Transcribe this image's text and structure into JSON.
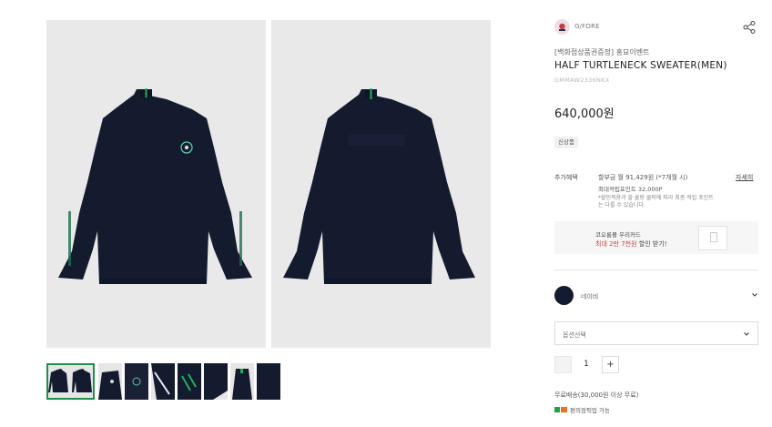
{
  "gallery": {
    "main_images": [
      {
        "label": "front-view"
      },
      {
        "label": "back-view"
      }
    ],
    "thumbnails_count": 8,
    "active_thumbnail": 0
  },
  "product": {
    "brand": "G/FORE",
    "promo_tag": "[백화점상품권증정] 홍묘이벤트",
    "name": "HALF TURTLENECK SWEATER(MEN)",
    "code": "GMMAW2336NKX",
    "price": "640,000원",
    "badge": "신상품"
  },
  "benefits": {
    "label": "추가혜택",
    "line1": "할부금 월 91,429원 (*7개월 시)",
    "line2": "최대적립포인트 32,000P",
    "note": "*할인적용과 쓸 쿨랑 쿨퍼에 따라 최종 적립 포인트는 다를 수 있습니다.",
    "detail_link": "자세히"
  },
  "banner": {
    "line1": "코오롱몰 우리카드",
    "line2_prefix": "",
    "line2_highlight": "최대 2만 7천원",
    "line2_suffix": " 할인 받기!"
  },
  "options": {
    "color_name": "네이비",
    "color_hex": "#151b2f",
    "select_placeholder": "옵션선택",
    "quantity": "1",
    "plus": "+"
  },
  "shipping": {
    "text": "무료배송(30,000원 이상 무료)",
    "pickup_text": "편의점픽업 가능"
  },
  "colors": {
    "navy": "#151b2f",
    "accent_green": "#1f8f4a",
    "sale_red": "#d23a3a"
  }
}
